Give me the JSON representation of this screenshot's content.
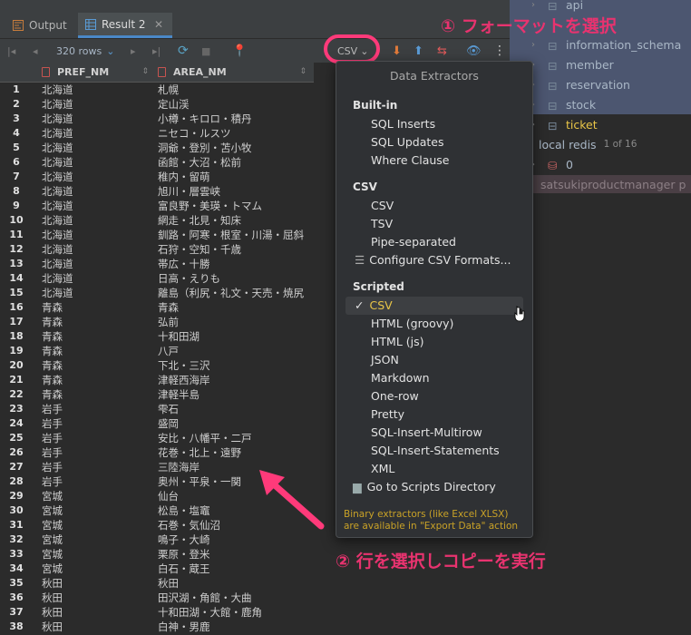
{
  "tabs": [
    {
      "label": "Output"
    },
    {
      "label": "Result 2"
    }
  ],
  "toolbar": {
    "rows_label": "320 rows",
    "format_label": "CSV"
  },
  "grid": {
    "columns": [
      "PREF_NM",
      "AREA_NM"
    ],
    "rows": [
      [
        "1",
        "北海道",
        "札幌"
      ],
      [
        "2",
        "北海道",
        "定山渓"
      ],
      [
        "3",
        "北海道",
        "小樽・キロロ・積丹"
      ],
      [
        "4",
        "北海道",
        "ニセコ・ルスツ"
      ],
      [
        "5",
        "北海道",
        "洞爺・登別・苫小牧"
      ],
      [
        "6",
        "北海道",
        "函館・大沼・松前"
      ],
      [
        "7",
        "北海道",
        "稚内・留萌"
      ],
      [
        "8",
        "北海道",
        "旭川・層雲峡"
      ],
      [
        "9",
        "北海道",
        "富良野・美瑛・トマム"
      ],
      [
        "10",
        "北海道",
        "網走・北見・知床"
      ],
      [
        "11",
        "北海道",
        "釧路・阿寒・根室・川湯・屈斜"
      ],
      [
        "12",
        "北海道",
        "石狩・空知・千歳"
      ],
      [
        "13",
        "北海道",
        "帯広・十勝"
      ],
      [
        "14",
        "北海道",
        "日高・えりも"
      ],
      [
        "15",
        "北海道",
        "離島（利尻・礼文・天売・焼尻"
      ],
      [
        "16",
        "青森",
        "青森"
      ],
      [
        "17",
        "青森",
        "弘前"
      ],
      [
        "18",
        "青森",
        "十和田湖"
      ],
      [
        "19",
        "青森",
        "八戸"
      ],
      [
        "20",
        "青森",
        "下北・三沢"
      ],
      [
        "21",
        "青森",
        "津軽西海岸"
      ],
      [
        "22",
        "青森",
        "津軽半島"
      ],
      [
        "23",
        "岩手",
        "雫石"
      ],
      [
        "24",
        "岩手",
        "盛岡"
      ],
      [
        "25",
        "岩手",
        "安比・八幡平・二戸"
      ],
      [
        "26",
        "岩手",
        "花巻・北上・遠野"
      ],
      [
        "27",
        "岩手",
        "三陸海岸"
      ],
      [
        "28",
        "岩手",
        "奥州・平泉・一関"
      ],
      [
        "29",
        "宮城",
        "仙台"
      ],
      [
        "30",
        "宮城",
        "松島・塩竈"
      ],
      [
        "31",
        "宮城",
        "石巻・気仙沼"
      ],
      [
        "32",
        "宮城",
        "鳴子・大崎"
      ],
      [
        "33",
        "宮城",
        "栗原・登米"
      ],
      [
        "34",
        "宮城",
        "白石・蔵王"
      ],
      [
        "35",
        "秋田",
        "秋田"
      ],
      [
        "36",
        "秋田",
        "田沢湖・角館・大曲"
      ],
      [
        "37",
        "秋田",
        "十和田湖・大館・鹿角"
      ],
      [
        "38",
        "秋田",
        "白神・男鹿"
      ]
    ]
  },
  "tree": {
    "items": [
      {
        "label": "api"
      },
      {
        "label": "information_schema"
      },
      {
        "label": "member"
      },
      {
        "label": "reservation"
      },
      {
        "label": "stock"
      },
      {
        "label": "ticket"
      },
      {
        "label": "local redis"
      },
      {
        "label": "1 of 16"
      },
      {
        "label": "0"
      },
      {
        "label": "satsukiproductmanager p"
      }
    ]
  },
  "popup": {
    "title": "Data Extractors",
    "sections": {
      "builtin": "Built-in",
      "csv": "CSV",
      "scripted": "Scripted"
    },
    "builtin_items": [
      "SQL Inserts",
      "SQL Updates",
      "Where Clause"
    ],
    "csv_items": [
      "CSV",
      "TSV",
      "Pipe-separated",
      "Configure CSV Formats..."
    ],
    "scripted_items": [
      "CSV",
      "HTML (groovy)",
      "HTML (js)",
      "JSON",
      "Markdown",
      "One-row",
      "Pretty",
      "SQL-Insert-Multirow",
      "SQL-Insert-Statements",
      "XML"
    ],
    "scripts_dir": "Go to Scripts Directory",
    "note_line1": "Binary extractors (like Excel XLSX)",
    "note_line2": "are available in \"Export Data\" action",
    "checkmark": "✓"
  },
  "annotations": {
    "step1": "① フォーマットを選択",
    "step2": "② 行を選択しコピーを実行"
  },
  "colors": {
    "accent_pink": "#e8336f",
    "selection_blue": "#4c5670",
    "note_gold": "#c9a227"
  }
}
